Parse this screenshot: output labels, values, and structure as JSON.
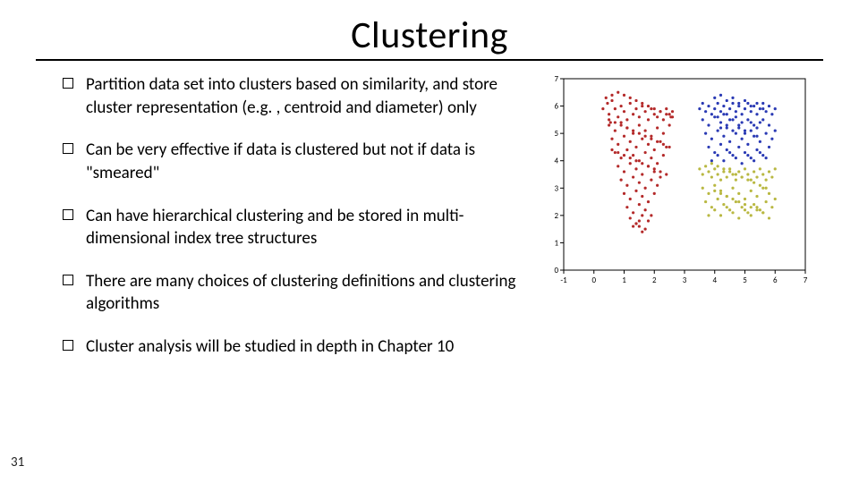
{
  "title": "Clustering",
  "page_number": "31",
  "bullets": [
    "Partition data set into clusters based on similarity, and store cluster representation (e.g. , centroid and diameter) only",
    "Can be very effective if data is clustered but not if data is \"smeared\"",
    "Can have hierarchical clustering and be stored in multi-dimensional index tree structures",
    "There are many choices of clustering definitions and clustering algorithms",
    "Cluster analysis will be studied in depth in Chapter 10"
  ],
  "chart_data": {
    "type": "scatter",
    "title": "",
    "xlabel": "",
    "ylabel": "",
    "xlim": [
      -1,
      7
    ],
    "ylim": [
      0,
      7
    ],
    "xticks": [
      -1,
      0,
      1,
      2,
      3,
      4,
      5,
      6,
      7
    ],
    "yticks": [
      0,
      1,
      2,
      3,
      4,
      5,
      6,
      7
    ],
    "series": [
      {
        "name": "red",
        "color": "#b42a2a",
        "x": [
          0.3,
          0.45,
          0.5,
          0.55,
          0.6,
          0.7,
          0.8,
          0.9,
          1.0,
          1.1,
          1.2,
          1.3,
          1.4,
          1.5,
          1.6,
          1.7,
          1.8,
          1.9,
          2.0,
          2.1,
          2.2,
          2.3,
          2.4,
          2.5,
          2.55,
          2.6,
          0.5,
          0.7,
          0.9,
          1.1,
          1.3,
          1.5,
          1.7,
          1.9,
          2.1,
          2.3,
          2.5,
          0.6,
          0.8,
          1.0,
          1.2,
          1.4,
          1.6,
          1.8,
          2.0,
          2.2,
          2.4,
          0.7,
          0.9,
          1.1,
          1.3,
          1.5,
          1.7,
          1.9,
          2.1,
          2.3,
          0.8,
          1.0,
          1.2,
          1.4,
          1.6,
          1.8,
          2.0,
          2.2,
          0.9,
          1.1,
          1.3,
          1.5,
          1.7,
          1.9,
          2.1,
          1.0,
          1.2,
          1.4,
          1.6,
          1.8,
          2.0,
          1.1,
          1.3,
          1.5,
          1.7,
          1.9,
          1.2,
          1.4,
          1.6,
          1.8,
          1.3,
          1.5,
          1.7,
          1.4,
          1.6,
          1.5,
          0.4,
          0.6,
          0.8,
          1.0,
          1.2,
          1.4,
          1.6,
          1.8,
          2.0,
          2.2,
          2.4,
          2.6,
          0.5,
          0.7,
          0.9,
          1.1,
          1.3,
          1.5,
          1.7,
          1.9,
          2.1,
          2.3,
          2.5,
          0.6,
          0.8,
          1.0,
          1.2,
          1.4,
          1.6,
          1.8,
          2.0,
          2.2,
          2.4
        ],
        "y": [
          5.9,
          6.1,
          5.7,
          5.4,
          6.2,
          5.9,
          5.6,
          6.0,
          5.8,
          5.5,
          6.1,
          5.7,
          5.9,
          5.6,
          6.0,
          5.8,
          5.5,
          5.9,
          5.7,
          5.6,
          5.8,
          5.5,
          5.9,
          5.7,
          5.6,
          5.8,
          5.3,
          5.1,
          5.4,
          5.2,
          5.0,
          5.3,
          5.1,
          4.9,
          5.2,
          5.0,
          5.3,
          4.8,
          4.6,
          4.9,
          4.7,
          4.5,
          4.8,
          4.6,
          4.4,
          4.7,
          4.5,
          4.3,
          4.1,
          4.4,
          4.2,
          4.0,
          4.3,
          4.1,
          3.9,
          4.2,
          3.8,
          3.6,
          3.9,
          3.7,
          3.5,
          3.8,
          3.6,
          3.4,
          3.3,
          3.1,
          3.4,
          3.2,
          3.0,
          3.3,
          3.1,
          2.8,
          2.6,
          2.9,
          2.7,
          2.5,
          2.8,
          2.3,
          2.1,
          2.4,
          2.2,
          2.0,
          1.9,
          1.7,
          2.0,
          1.8,
          1.6,
          1.8,
          1.5,
          1.7,
          1.4,
          1.6,
          6.3,
          6.4,
          6.5,
          6.4,
          6.3,
          6.2,
          6.1,
          6.0,
          5.9,
          5.8,
          5.7,
          5.6,
          5.5,
          5.4,
          5.3,
          5.2,
          5.1,
          5.0,
          4.9,
          4.8,
          4.7,
          4.6,
          4.5,
          4.4,
          4.3,
          4.2,
          4.1,
          4.0,
          3.9,
          3.8,
          3.7,
          3.6,
          3.5
        ]
      },
      {
        "name": "blue",
        "color": "#2a3ab4",
        "x": [
          3.5,
          3.6,
          3.7,
          3.8,
          3.9,
          4.0,
          4.1,
          4.2,
          4.3,
          4.4,
          4.5,
          4.6,
          4.7,
          4.8,
          4.9,
          5.0,
          5.1,
          5.2,
          5.3,
          5.4,
          5.5,
          5.6,
          5.7,
          5.8,
          5.9,
          6.0,
          3.6,
          3.8,
          4.0,
          4.2,
          4.4,
          4.6,
          4.8,
          5.0,
          5.2,
          5.4,
          5.6,
          5.8,
          6.0,
          3.7,
          3.9,
          4.1,
          4.3,
          4.5,
          4.7,
          4.9,
          5.1,
          5.3,
          5.5,
          5.7,
          5.9,
          3.8,
          4.0,
          4.2,
          4.4,
          4.6,
          4.8,
          5.0,
          5.2,
          5.4,
          5.6,
          5.8,
          3.9,
          4.1,
          4.3,
          4.5,
          4.7,
          4.9,
          5.1,
          5.3,
          5.5,
          5.7,
          4.0,
          4.2,
          4.4,
          4.6,
          4.8,
          5.0,
          5.2,
          5.4,
          5.6,
          4.1,
          4.3,
          4.5,
          4.7,
          4.9,
          5.1,
          5.3,
          5.5,
          4.2,
          4.4,
          4.6,
          4.8,
          5.0,
          5.2,
          5.4
        ],
        "y": [
          5.9,
          6.1,
          5.8,
          6.0,
          5.7,
          5.9,
          6.1,
          5.8,
          6.0,
          5.7,
          5.9,
          6.1,
          5.8,
          6.0,
          5.7,
          5.9,
          6.1,
          5.8,
          6.0,
          5.7,
          5.9,
          6.1,
          5.8,
          6.0,
          5.7,
          5.9,
          5.5,
          5.3,
          5.6,
          5.4,
          5.2,
          5.5,
          5.3,
          5.1,
          5.4,
          5.2,
          5.5,
          5.3,
          5.1,
          5.0,
          4.8,
          5.1,
          4.9,
          4.7,
          5.0,
          4.8,
          4.6,
          4.9,
          4.7,
          5.0,
          4.8,
          4.5,
          4.3,
          4.6,
          4.4,
          4.2,
          4.5,
          4.3,
          4.1,
          4.4,
          4.2,
          4.5,
          4.0,
          4.2,
          4.0,
          4.3,
          4.1,
          3.9,
          4.2,
          4.0,
          4.3,
          4.1,
          6.3,
          6.4,
          6.2,
          6.3,
          6.1,
          6.2,
          6.0,
          6.1,
          5.9,
          5.6,
          5.7,
          5.5,
          5.6,
          5.4,
          5.5,
          5.3,
          5.4,
          5.2,
          5.3,
          5.1,
          5.2,
          5.0,
          5.1,
          4.9
        ]
      },
      {
        "name": "green",
        "color": "#b9b842",
        "x": [
          3.5,
          3.6,
          3.7,
          3.8,
          3.9,
          4.0,
          4.1,
          4.2,
          4.3,
          4.4,
          4.5,
          4.6,
          4.7,
          4.8,
          4.9,
          5.0,
          5.1,
          5.2,
          5.3,
          5.4,
          5.5,
          5.6,
          5.7,
          5.8,
          5.9,
          6.0,
          3.6,
          3.8,
          4.0,
          4.2,
          4.4,
          4.6,
          4.8,
          5.0,
          5.2,
          5.4,
          5.6,
          5.8,
          6.0,
          3.7,
          3.9,
          4.1,
          4.3,
          4.5,
          4.7,
          4.9,
          5.1,
          5.3,
          5.5,
          5.7,
          5.9,
          3.8,
          4.0,
          4.2,
          4.4,
          4.6,
          4.8,
          5.0,
          5.2,
          5.4,
          5.6,
          5.8,
          3.9,
          4.1,
          4.3,
          4.5,
          4.7,
          4.9,
          5.1,
          5.3,
          5.5,
          5.7,
          4.0,
          4.2,
          4.4,
          4.6,
          4.8,
          5.0,
          5.2,
          5.4,
          5.6
        ],
        "y": [
          3.7,
          3.5,
          3.8,
          3.6,
          3.4,
          3.7,
          3.5,
          3.3,
          3.6,
          3.4,
          3.7,
          3.5,
          3.3,
          3.6,
          3.4,
          3.7,
          3.5,
          3.3,
          3.6,
          3.4,
          3.7,
          3.5,
          3.3,
          3.6,
          3.4,
          3.7,
          3.0,
          2.8,
          3.1,
          2.9,
          2.7,
          3.0,
          2.8,
          2.6,
          2.9,
          2.7,
          3.0,
          2.8,
          2.6,
          2.5,
          2.3,
          2.6,
          2.4,
          2.2,
          2.5,
          2.3,
          2.1,
          2.4,
          2.2,
          2.5,
          2.3,
          2.0,
          2.2,
          2.0,
          2.3,
          2.1,
          1.9,
          2.2,
          2.0,
          2.3,
          2.1,
          1.9,
          3.9,
          3.8,
          3.7,
          3.6,
          3.5,
          3.4,
          3.3,
          3.2,
          3.1,
          3.0,
          2.9,
          2.8,
          2.7,
          2.6,
          2.5,
          2.4,
          2.3,
          2.2,
          2.1
        ]
      }
    ]
  }
}
